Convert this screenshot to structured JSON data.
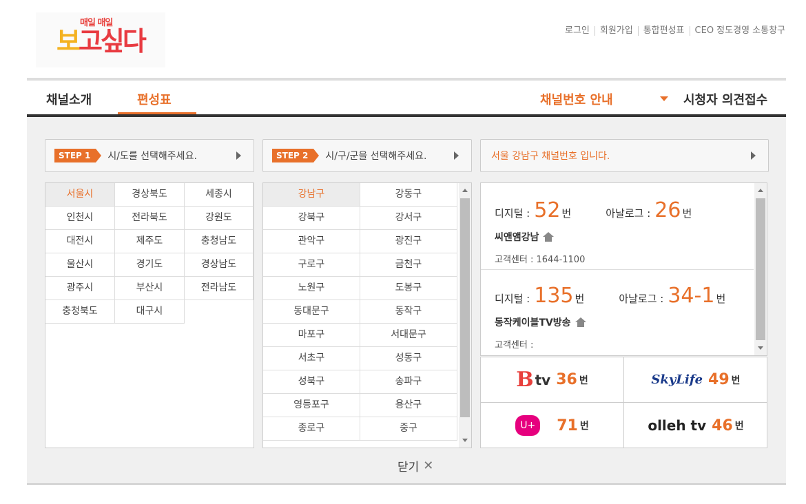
{
  "header": {
    "logo_top": "매일 매일",
    "logo_main_a": "보",
    "logo_main_b": "고싶다",
    "links": [
      "로그인",
      "회원가입",
      "통합편성표",
      "CEO 정도경영 소통창구"
    ]
  },
  "nav": {
    "tabs": [
      {
        "label": "채널소개",
        "active": false
      },
      {
        "label": "편성표",
        "active": true
      }
    ],
    "channel_guide": "채널번호 안내",
    "viewer_feedback": "시청자 의견접수"
  },
  "step1": {
    "badge": "STEP 1",
    "text": "시/도를 선택해주세요."
  },
  "step2": {
    "badge": "STEP 2",
    "text": "시/구/군을 선택해주세요."
  },
  "step3": {
    "text": "서울 강남구 채널번호 입니다."
  },
  "regions": [
    "서울시",
    "경상북도",
    "세종시",
    "인천시",
    "전라북도",
    "강원도",
    "대전시",
    "제주도",
    "충청남도",
    "울산시",
    "경기도",
    "경상남도",
    "광주시",
    "부산시",
    "전라남도",
    "충청북도",
    "대구시"
  ],
  "selected_region": "서울시",
  "districts": [
    "강남구",
    "강동구",
    "강북구",
    "강서구",
    "관악구",
    "광진구",
    "구로구",
    "금천구",
    "노원구",
    "도봉구",
    "동대문구",
    "동작구",
    "마포구",
    "서대문구",
    "서초구",
    "성동구",
    "성북구",
    "송파구",
    "영등포구",
    "용산구",
    "종로구",
    "중구"
  ],
  "selected_district": "강남구",
  "providers": [
    {
      "digital_label": "디지털 :",
      "digital": "52",
      "digital_unit": "번",
      "analog_label": "아날로그 :",
      "analog": "26",
      "analog_unit": "번",
      "name": "씨앤앰강남",
      "cs": "고객센터 : 1644-1100"
    },
    {
      "digital_label": "디지털 :",
      "digital": "135",
      "digital_unit": "번",
      "analog_label": "아날로그 :",
      "analog": "34-1",
      "analog_unit": "번",
      "name": "동작케이블TV방송",
      "cs": "고객센터 :"
    }
  ],
  "platforms": {
    "btv": {
      "logo_b": "B",
      "logo_t": "tv",
      "num": "36",
      "unit": "번"
    },
    "skylife": {
      "logo": "SkyLife",
      "num": "49",
      "unit": "번"
    },
    "uplus": {
      "logo": "U+",
      "num": "71",
      "unit": "번"
    },
    "olleh": {
      "logo": "olleh tv",
      "num": "46",
      "unit": "번"
    }
  },
  "close_label": "닫기",
  "colors": {
    "accent": "#e8702a",
    "dark": "#333333",
    "panel": "#f0f0f0"
  }
}
